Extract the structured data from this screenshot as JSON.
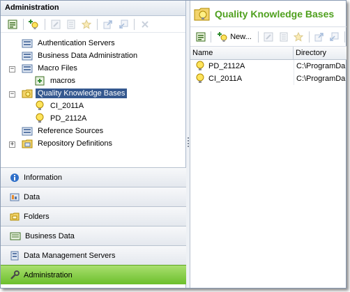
{
  "left_panel": {
    "title": "Administration",
    "toolbar": [
      "properties-icon",
      "add-icon",
      "edit-icon",
      "grid-icon",
      "favorite-icon",
      "export-icon",
      "import-icon",
      "delete-icon"
    ],
    "tree": [
      {
        "label": "Authentication Servers",
        "icon": "server-folder-icon",
        "level": 1
      },
      {
        "label": "Business Data Administration",
        "icon": "server-folder-icon",
        "level": 1
      },
      {
        "label": "Macro Files",
        "icon": "server-folder-icon",
        "level": 1,
        "expander": "−"
      },
      {
        "label": "macros",
        "icon": "macro-icon",
        "level": 2
      },
      {
        "label": "Quality Knowledge Bases",
        "icon": "qkb-folder-icon",
        "level": 1,
        "expander": "−",
        "selected": true
      },
      {
        "label": "CI_2011A",
        "icon": "lightbulb-icon",
        "level": 2
      },
      {
        "label": "PD_2112A",
        "icon": "lightbulb-icon",
        "level": 2
      },
      {
        "label": "Reference Sources",
        "icon": "server-folder-icon",
        "level": 1
      },
      {
        "label": "Repository Definitions",
        "icon": "repository-icon",
        "level": 1,
        "expander": "+"
      }
    ]
  },
  "nav": [
    {
      "label": "Information",
      "icon": "info-icon"
    },
    {
      "label": "Data",
      "icon": "data-icon"
    },
    {
      "label": "Folders",
      "icon": "folders-icon"
    },
    {
      "label": "Business Data",
      "icon": "business-data-icon"
    },
    {
      "label": "Data Management Servers",
      "icon": "servers-icon"
    },
    {
      "label": "Administration",
      "icon": "wrench-icon",
      "active": true
    }
  ],
  "right_panel": {
    "title": "Quality Knowledge Bases",
    "new_label": "New...",
    "columns": [
      "Name",
      "Directory"
    ],
    "rows": [
      {
        "name": "PD_2112A",
        "directory": "C:\\ProgramDa"
      },
      {
        "name": "CI_2011A",
        "directory": "C:\\ProgramDa"
      }
    ]
  },
  "colors": {
    "accent_green": "#4fa01e",
    "selection_blue": "#34588f",
    "active_nav": "#7ec93c"
  }
}
